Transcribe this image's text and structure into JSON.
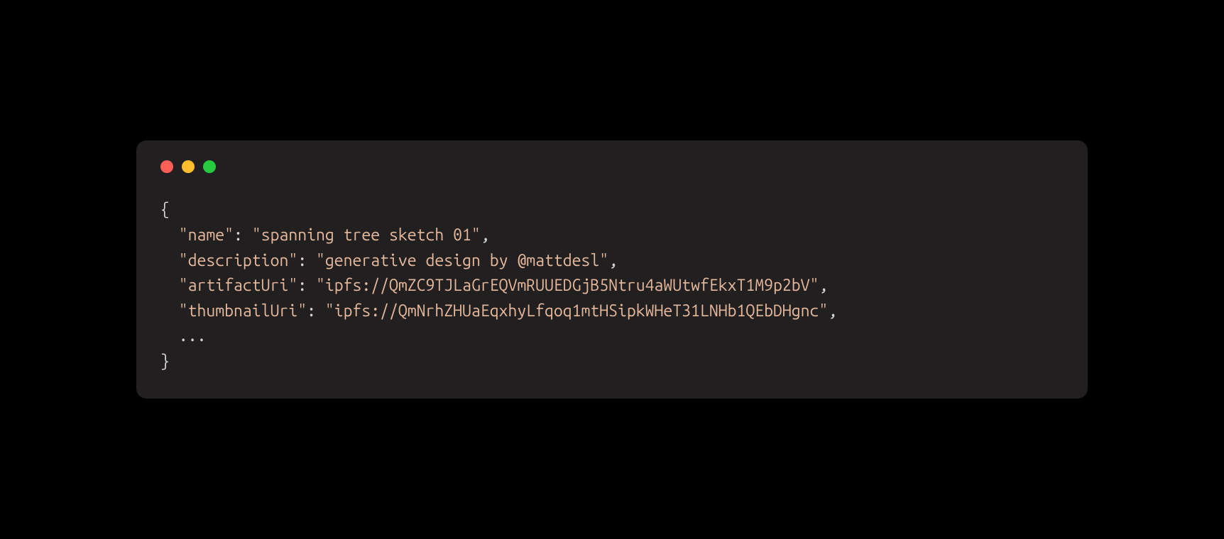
{
  "window": {
    "traffic_lights": [
      "close",
      "minimize",
      "zoom"
    ]
  },
  "code": {
    "open_brace": "{",
    "close_brace": "}",
    "indent": "  ",
    "ellipsis": "...",
    "entries": [
      {
        "key": "\"name\"",
        "sep": ": ",
        "value": "\"spanning tree sketch 01\"",
        "comma": ","
      },
      {
        "key": "\"description\"",
        "sep": ": ",
        "value": "\"generative design by @mattdesl\"",
        "comma": ","
      },
      {
        "key": "\"artifactUri\"",
        "sep": ": ",
        "value": "\"ipfs://QmZC9TJLaGrEQVmRUUEDGjB5Ntru4aWUtwfEkxT1M9p2bV\"",
        "comma": ","
      },
      {
        "key": "\"thumbnailUri\"",
        "sep": ": ",
        "value": "\"ipfs://QmNrhZHUaEqxhyLfqoq1mtHSipkWHeT31LNHb1QEbDHgnc\"",
        "comma": ","
      }
    ]
  }
}
